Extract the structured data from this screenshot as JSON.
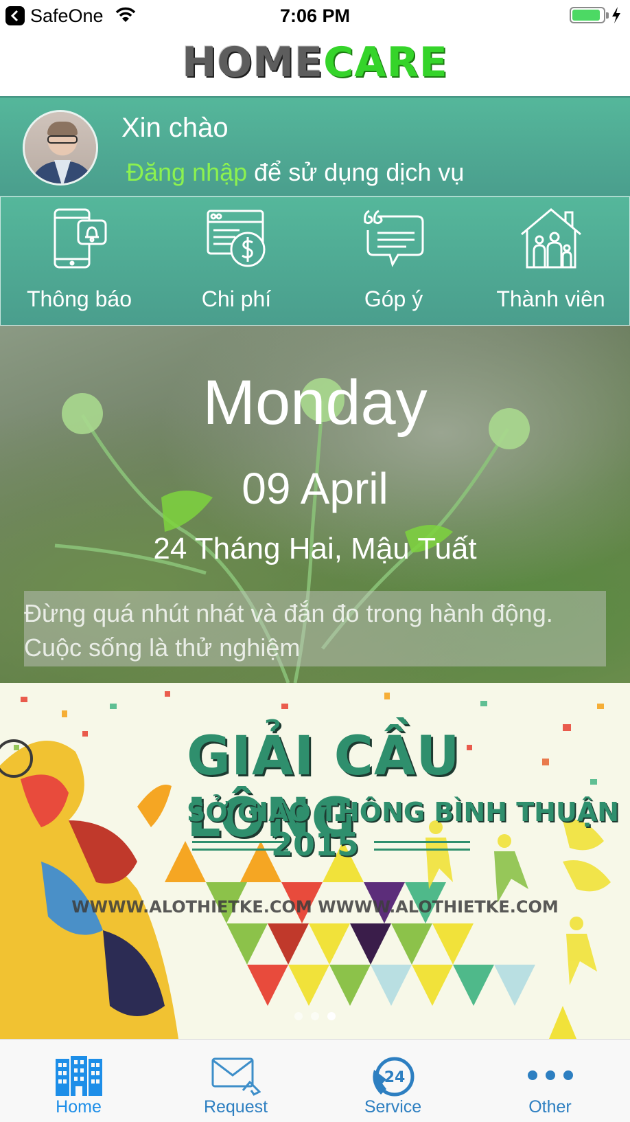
{
  "status_bar": {
    "carrier": "SafeOne",
    "time": "7:06 PM",
    "battery_level": 0.85
  },
  "header": {
    "logo_part1": "HOME",
    "logo_part2": "CARE"
  },
  "greeting": {
    "hello": "Xin chào",
    "login_link": "Đăng nhập",
    "login_suffix": " để sử dụng dịch vụ"
  },
  "quick_menu": [
    {
      "label": "Thông báo",
      "icon": "phone-bell-icon"
    },
    {
      "label": "Chi phí",
      "icon": "invoice-dollar-icon"
    },
    {
      "label": "Góp ý",
      "icon": "quote-bubble-icon"
    },
    {
      "label": "Thành viên",
      "icon": "family-house-icon"
    }
  ],
  "date_banner": {
    "day": "Monday",
    "date": "09 April",
    "lunar": "24 Tháng Hai, Mậu Tuất",
    "quote": "Đừng quá nhút nhát và đắn đo trong hành động. Cuộc sống là thử nghiệm"
  },
  "promo": {
    "title": "GIẢI CẦU LÔNG",
    "subtitle": "SỞ GIAO THÔNG BÌNH THUẬN",
    "year": "2015",
    "watermark": "WWWW.ALOTHIETKE.COM   WWWW.ALOTHIETKE.COM",
    "slide_index": 3,
    "slide_count": 3
  },
  "tab_bar": [
    {
      "label": "Home",
      "icon": "building-icon",
      "active": true
    },
    {
      "label": "Request",
      "icon": "mail-icon",
      "active": false
    },
    {
      "label": "Service",
      "icon": "support-24-icon",
      "active": false
    },
    {
      "label": "Other",
      "icon": "more-dots-icon",
      "active": false
    }
  ],
  "colors": {
    "teal": "#4fa995",
    "login_green": "#8cf24f",
    "tab_blue": "#1d8ee8",
    "logo_green": "#35d42a"
  }
}
